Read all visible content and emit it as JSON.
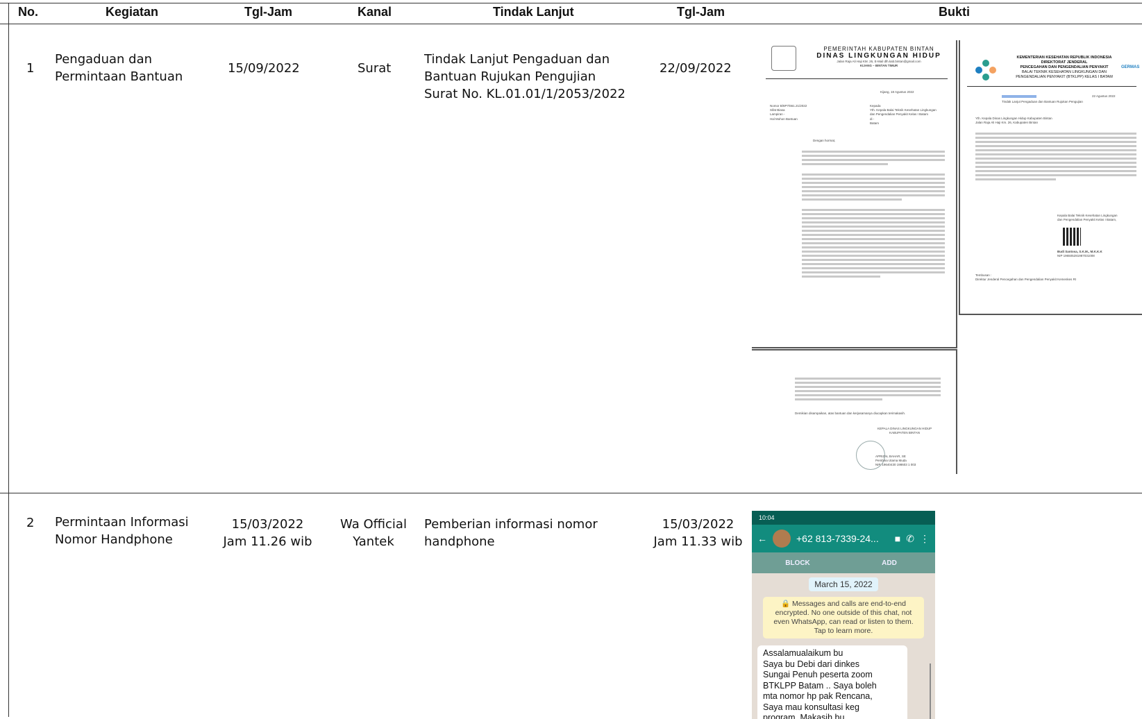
{
  "headers": {
    "no": "No.",
    "kegiatan": "Kegiatan",
    "tgl_jam": "Tgl-Jam",
    "kanal": "Kanal",
    "tindak_lanjut": "Tindak Lanjut",
    "tgl_jam2": "Tgl-Jam",
    "bukti": "Bukti"
  },
  "rows": [
    {
      "no": "1",
      "kegiatan": [
        "Pengaduan dan",
        "Permintaan Bantuan"
      ],
      "tgl_jam": [
        "15/09/2022"
      ],
      "kanal": [
        "Surat"
      ],
      "tindak_lanjut": [
        "Tindak Lanjut Pengaduan dan",
        "Bantuan Rujukan Pengujian",
        "Surat No. KL.01.01/1/2053/2022"
      ],
      "tgl_jam2": [
        "22/09/2022"
      ]
    },
    {
      "no": "2",
      "kegiatan": [
        "Permintaan Informasi",
        "Nomor Handphone"
      ],
      "tgl_jam": [
        "15/03/2022",
        "Jam 11.26 wib"
      ],
      "kanal": [
        "Wa Official",
        "Yantek"
      ],
      "tindak_lanjut": [
        "Pemberian informasi nomor",
        "handphone"
      ],
      "tgl_jam2": [
        "15/03/2022",
        "Jam 11.33 wib"
      ]
    }
  ],
  "doc1": {
    "org1": "PEMERINTAH KABUPATEN BINTAN",
    "org2": "DINAS LINGKUNGAN HIDUP",
    "addr": "Jalan Raja Ali Haji KM. 26, E-Mail dlh.kab.bintan@gmail.com",
    "city": "KIJANG – BINTAN TIMUR",
    "date": "Kijang, 18 Agustus 2022",
    "meta": [
      "Nomor   B/6P7/661.21/2022",
      "Sifat   Biasa",
      "Lampiran  -",
      "Hal   Mohon Bantuan"
    ],
    "to": [
      "Kepada",
      "Yth. Kepala Balai Teknik Kesehatan Lingkungan",
      "dan Pengendalian Penyakit Kelas I Batam",
      "di -",
      "Batam"
    ],
    "greeting": "Dengan hormat,",
    "sign": [
      "KEPALA DINAS LINGKUNGAN HIDUP",
      "KABUPATEN BINTAN",
      "APRIZAL BAHAR, SE",
      "Pembina Utama Muda",
      "NIP. 19640430 198603 1 003"
    ],
    "closing": "Demikian disampaikan, atas bantuan dan kerjasamanya diucapkan terimakasih."
  },
  "doc2": {
    "h1": "KEMENTERIAN KESEHATAN REPUBLIK INDONESIA",
    "h2": "DIREKTORAT JENDERAL",
    "h3": "PENCEGAHAN DAN PENGENDALIAN PENYAKIT",
    "h4": "BALAI TEKNIK KESEHATAN LINGKUNGAN DAN",
    "h5": "PENGENDALIAN PENYAKIT (BTKLPP) KELAS I BATAM",
    "logo_text": "GERMAS",
    "date": "22 Agustus 2022",
    "hal": "Tindak Lanjut Pengaduan dan Bantuan Rujukan Pengujian",
    "to": "Yth. Kepala Dinas Lingkungan Hidup Kabupaten Bintan",
    "addr": "Jalan Raja Ali Haji Km. 26, Kabupaten Bintan",
    "sign1": "Kepala Balai Teknik Kesehatan Lingkungan",
    "sign2": "dan Pengendalian Penyakit Kelas I Batam,",
    "signer": "Budi Santosa, S.K.M., M.K.K.K",
    "nip": "NIP 196505281987031008",
    "tembusan": "Tembusan :",
    "tembusan_to": "Direktur Jenderal Pencegahan dan Pengendalian Penyakit Kemenkes RI"
  },
  "wa": {
    "time": "10:04",
    "contact": "+62 813-7339-24...",
    "block": "BLOCK",
    "add": "ADD",
    "date_chip": "March 15, 2022",
    "encryption": "🔒 Messages and calls are end-to-end encrypted. No one outside of this chat, not even WhatsApp, can read or listen to them. Tap to learn more.",
    "message": [
      "Assalamualaikum bu",
      "Saya bu Debi dari dinkes",
      "Sungai Penuh peserta zoom",
      "BTKLPP Batam .. Saya boleh",
      "mta nomor hp pak Rencana,",
      "Saya mau konsultasi keg",
      "program. Makasih bu"
    ]
  }
}
